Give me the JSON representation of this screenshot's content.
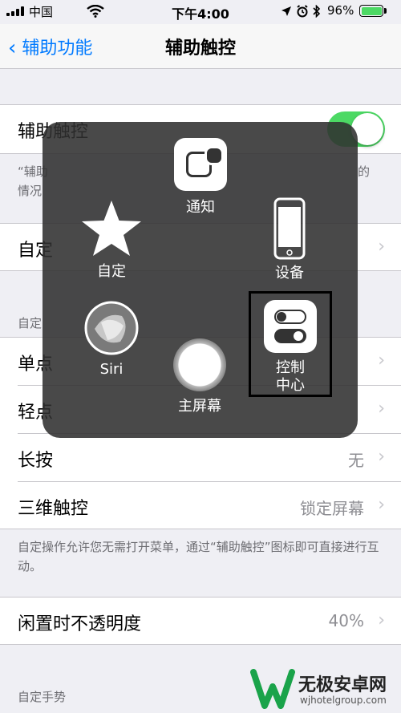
{
  "status_bar": {
    "carrier": "中国",
    "time": "下午4:00",
    "battery_percent": "96%"
  },
  "nav": {
    "back_label": "辅助功能",
    "title": "辅助触控"
  },
  "toggle_row": {
    "label": "辅助触控",
    "on": true
  },
  "toggle_footer_left": "“辅助",
  "toggle_footer_left2": "情况",
  "toggle_footer_right": "的",
  "customize_row": {
    "label": "自定"
  },
  "section_custom_actions": "自定",
  "actions": [
    {
      "label": "单点",
      "value": ""
    },
    {
      "label": "轻点",
      "value": ""
    },
    {
      "label": "长按",
      "value": "无"
    },
    {
      "label": "三维触控",
      "value": "锁定屏幕"
    }
  ],
  "actions_footer": "自定操作允许您无需打开菜单，通过“辅助触控”图标即可直接进行互动。",
  "opacity_row": {
    "label": "闲置时不透明度",
    "value": "40%"
  },
  "section_gestures": "自定手势",
  "menu": {
    "notification": "通知",
    "custom": "自定",
    "device": "设备",
    "siri": "Siri",
    "home": "主屏幕",
    "control_center_line1": "控制",
    "control_center_line2": "中心"
  },
  "watermark": {
    "name": "无极安卓网",
    "url": "wjhotelgroup.com"
  },
  "colors": {
    "accent": "#007aff",
    "toggle_on": "#4cd964"
  }
}
